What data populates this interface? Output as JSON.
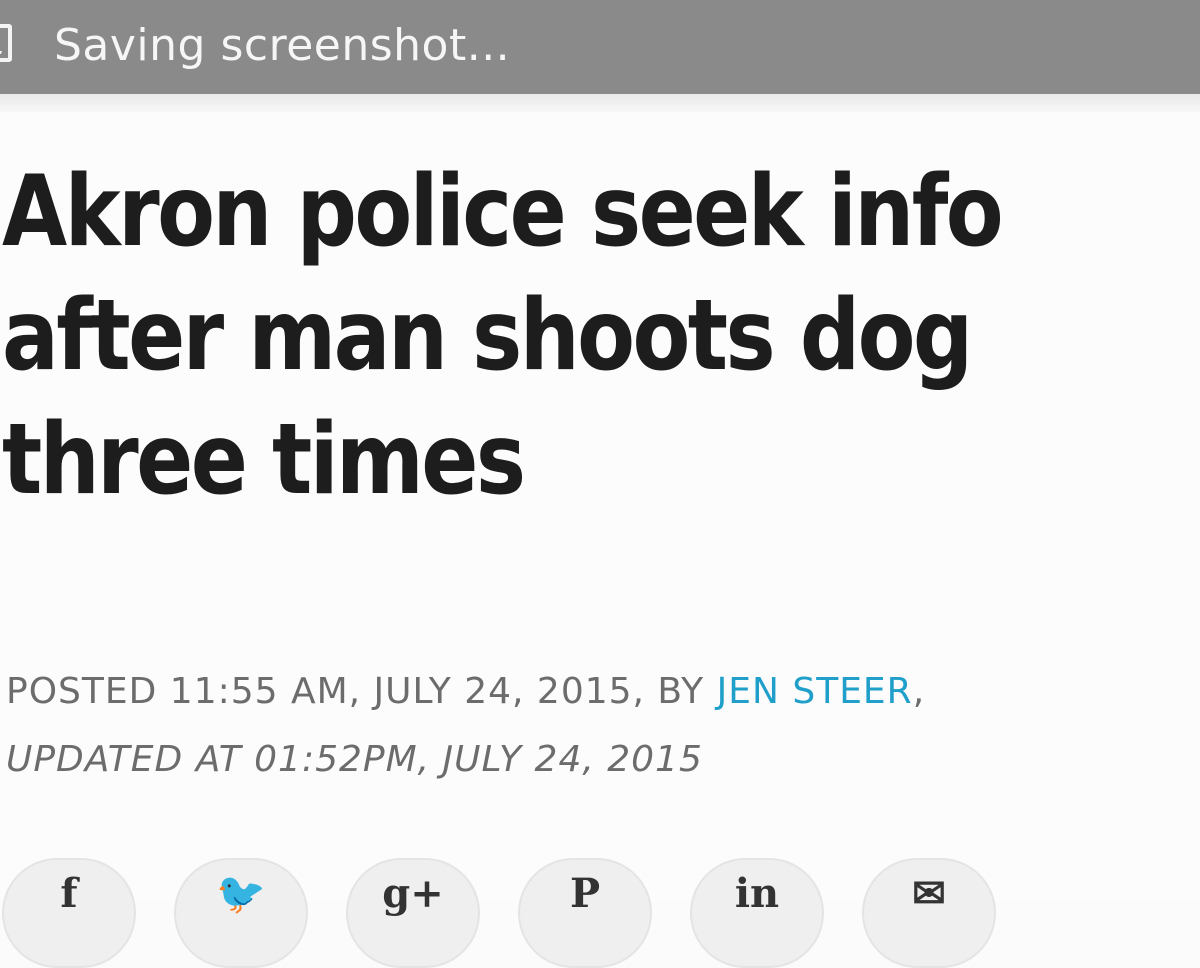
{
  "status_bar": {
    "icon": "screenshot-icon",
    "text": "Saving screenshot..."
  },
  "article": {
    "title": "Akron police seek info after man shoots dog three times",
    "posted_prefix": "POSTED 11:55 AM, JULY 24, 2015, BY ",
    "author": "JEN STEER",
    "posted_suffix": ",",
    "updated": "UPDATED AT 01:52PM, JULY 24, 2015"
  },
  "share_buttons": [
    {
      "icon": "facebook-icon",
      "glyph": "f"
    },
    {
      "icon": "twitter-icon",
      "glyph": "🐦"
    },
    {
      "icon": "google-plus-icon",
      "glyph": "g+"
    },
    {
      "icon": "pinterest-icon",
      "glyph": "P"
    },
    {
      "icon": "linkedin-icon",
      "glyph": "in"
    },
    {
      "icon": "email-icon",
      "glyph": "✉"
    }
  ]
}
